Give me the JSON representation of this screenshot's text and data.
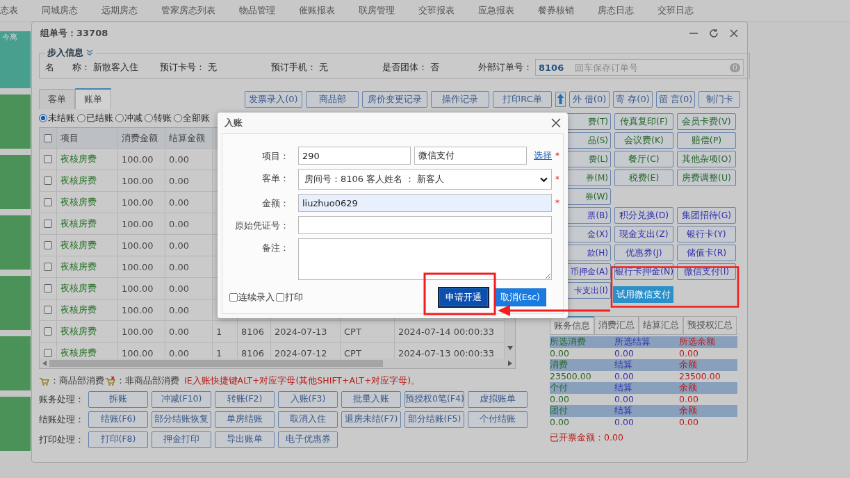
{
  "nav": {
    "items": [
      "态表",
      "同城房态",
      "远期房态",
      "管家房态列表",
      "物品管理",
      "催账报表",
      "联房管理",
      "交班报表",
      "应急报表",
      "餐券核销",
      "房态日志",
      "交班日志"
    ]
  },
  "side_tiles": {
    "badge": "今离"
  },
  "window": {
    "title": "组单号：33708"
  },
  "guest_info": {
    "legend": "步入信息",
    "fields": [
      {
        "label": "名　　称：",
        "value": "新散客入住"
      },
      {
        "label": "预订卡号：",
        "value": "无"
      },
      {
        "label": "预订手机：",
        "value": "无"
      },
      {
        "label": "是否团体：",
        "value": "否"
      }
    ],
    "external_order": {
      "label": "外部订单号：",
      "prefix": "8106",
      "placeholder": "回车保存订单号",
      "count": "0"
    }
  },
  "tabs": [
    {
      "label": "客单",
      "selected": false
    },
    {
      "label": "账单",
      "selected": true
    }
  ],
  "toolbar_left": [
    "发票录入(0)",
    "商品部",
    "房价变更记录",
    "操作记录",
    "打印RC单"
  ],
  "toolbar_right": [
    "外 借(0)",
    "寄 存(0)",
    "留 言(0)",
    "制门卡"
  ],
  "filters": [
    {
      "label": "未结账",
      "selected": true
    },
    {
      "label": "已结账",
      "selected": false
    },
    {
      "label": "冲减",
      "selected": false
    },
    {
      "label": "转账",
      "selected": false
    },
    {
      "label": "全部账",
      "selected": false
    }
  ],
  "table": {
    "header_checked": false,
    "columns": [
      "项目",
      "消费金额",
      "结算金额"
    ],
    "rows": [
      {
        "checked": false,
        "cells": [
          "夜核房费",
          "100.00",
          "0.00"
        ]
      },
      {
        "checked": false,
        "cells": [
          "夜核房费",
          "100.00",
          "0.00"
        ]
      },
      {
        "checked": false,
        "cells": [
          "夜核房费",
          "100.00",
          "0.00"
        ]
      },
      {
        "checked": false,
        "cells": [
          "夜核房费",
          "100.00",
          "0.00"
        ]
      },
      {
        "checked": false,
        "cells": [
          "夜核房费",
          "100.00",
          "0.00"
        ]
      },
      {
        "checked": false,
        "cells": [
          "夜核房费",
          "100.00",
          "0.00"
        ]
      },
      {
        "checked": false,
        "cells": [
          "夜核房费",
          "100.00",
          "0.00"
        ]
      },
      {
        "checked": false,
        "cells": [
          "夜核房费",
          "100.00",
          "0.00"
        ]
      },
      {
        "checked": false,
        "cells": [
          "夜核房费",
          "100.00",
          "0.00",
          "1",
          "8106",
          "2024-07-13",
          "CPT",
          "2024-07-14 00:00:33"
        ]
      },
      {
        "checked": false,
        "cells": [
          "夜核房费",
          "100.00",
          "0.00",
          "1",
          "8106",
          "2024-07-12",
          "CPT",
          "2024-07-13 00:00:33"
        ]
      }
    ]
  },
  "legend": {
    "goods": "：商品部消费",
    "non_goods": "：非商品部消费",
    "hint": "IE入账快捷键ALT+对应字母(其他SHIFT+ALT+对应字母)。"
  },
  "actions": [
    {
      "label": "账务处理：",
      "buttons": [
        "拆账",
        "冲减(F10)",
        "转账(F2)",
        "入账(F3)",
        "批量入账",
        "预授权0笔(F4)",
        "虚拟账单"
      ]
    },
    {
      "label": "结账处理：",
      "buttons": [
        "结账(F6)",
        "部分结账恢复",
        "单房结账",
        "取消入住",
        "退房未结(F7)",
        "部分结账(F5)",
        "个付结账"
      ]
    },
    {
      "label": "打印处理：",
      "buttons": [
        "打印(F8)",
        "押金打印",
        "导出账单",
        "电子优惠券"
      ]
    }
  ],
  "charge_groups": [
    {
      "kind": "consume",
      "rows": [
        [
          "费(T)",
          "传真复印(F)",
          "会员卡费(V)"
        ],
        [
          "品(S)",
          "会议费(K)",
          "赔偿(P)"
        ],
        [
          "费(L)",
          "餐厅(C)",
          "其他杂项(O)"
        ],
        [
          "券(M)",
          "税费(E)",
          "房费调整(U)"
        ],
        [
          "券(W)"
        ]
      ]
    },
    {
      "kind": "payment",
      "rows": [
        [
          "票(B)",
          "积分兑换(D)",
          "集团招待(G)"
        ],
        [
          "金(X)",
          "现金支出(Z)",
          "银行卡(Y)"
        ],
        [
          "款(H)",
          "优惠券(J)",
          "储值卡(R)"
        ],
        [
          "币押金(A)",
          "银行卡押金(N)",
          "微信支付(I)"
        ],
        [
          "卡支出(I)"
        ]
      ]
    }
  ],
  "trial_button": "试用微信支付",
  "summary_tabs": [
    {
      "label": "账务信息",
      "selected": true
    },
    {
      "label": "消费汇总",
      "selected": false
    },
    {
      "label": "结算汇总",
      "selected": false
    },
    {
      "label": "预授权汇总",
      "selected": false
    }
  ],
  "summary": [
    {
      "headers": [
        "所选消费",
        "所选结算",
        "所选余额"
      ],
      "values": [
        "0.00",
        "0.00",
        "0.00"
      ]
    },
    {
      "headers": [
        "消费",
        "结算",
        "余额"
      ],
      "values": [
        "23500.00",
        "0.00",
        "23500.00"
      ]
    },
    {
      "headers": [
        "个付",
        "结算",
        "余额"
      ],
      "values": [
        "0.00",
        "0.00",
        "0.00"
      ]
    },
    {
      "headers": [
        "团付",
        "结算",
        "余额"
      ],
      "values": [
        "0.00",
        "0.00",
        "0.00"
      ]
    }
  ],
  "invoiced": "已开票金额：0.00",
  "dialog": {
    "title": "入账",
    "required_mark": "*",
    "rows": [
      {
        "kind": "item",
        "label": "项目：",
        "code": "290",
        "name": "微信支付",
        "link": "选择",
        "required": true
      },
      {
        "kind": "select",
        "label": "客单：",
        "value": "房间号：8106 客人姓名 ： 新客人",
        "required": true
      },
      {
        "kind": "input",
        "label": "金额：",
        "value": "liuzhuo0629",
        "required": true,
        "highlighted": true
      },
      {
        "kind": "input",
        "label": "原始凭证号：",
        "required": false,
        "highlighted": false
      },
      {
        "kind": "textarea",
        "label": "备注：",
        "required": false
      }
    ],
    "options": [
      {
        "label": "连续录入",
        "checked": false
      },
      {
        "label": "打印",
        "checked": false
      }
    ],
    "buttons": [
      {
        "label": "申请开通",
        "focused": true
      },
      {
        "label": "取消(Esc)",
        "focused": false
      }
    ]
  }
}
